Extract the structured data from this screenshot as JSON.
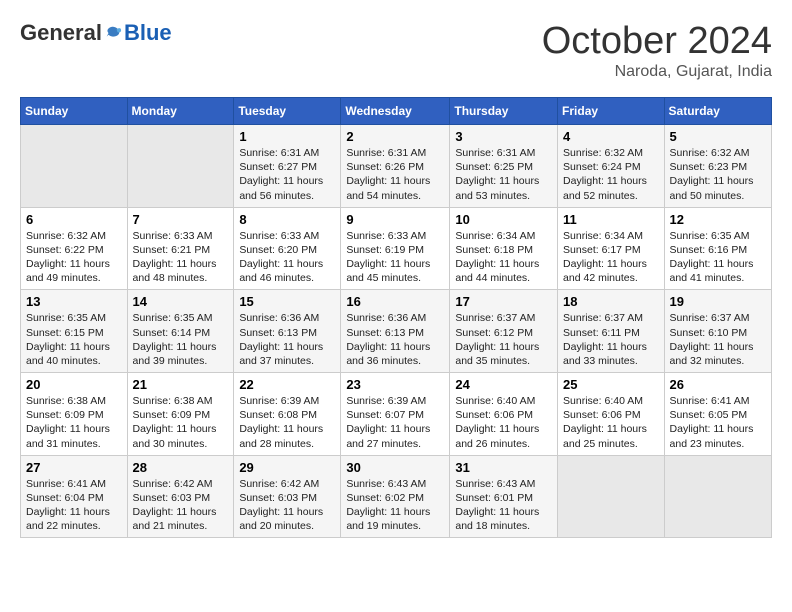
{
  "header": {
    "logo_general": "General",
    "logo_blue": "Blue",
    "month": "October 2024",
    "location": "Naroda, Gujarat, India"
  },
  "days_of_week": [
    "Sunday",
    "Monday",
    "Tuesday",
    "Wednesday",
    "Thursday",
    "Friday",
    "Saturday"
  ],
  "weeks": [
    [
      {
        "day": "",
        "sunrise": "",
        "sunset": "",
        "daylight": "",
        "empty": true
      },
      {
        "day": "",
        "sunrise": "",
        "sunset": "",
        "daylight": "",
        "empty": true
      },
      {
        "day": "1",
        "sunrise": "Sunrise: 6:31 AM",
        "sunset": "Sunset: 6:27 PM",
        "daylight": "Daylight: 11 hours and 56 minutes."
      },
      {
        "day": "2",
        "sunrise": "Sunrise: 6:31 AM",
        "sunset": "Sunset: 6:26 PM",
        "daylight": "Daylight: 11 hours and 54 minutes."
      },
      {
        "day": "3",
        "sunrise": "Sunrise: 6:31 AM",
        "sunset": "Sunset: 6:25 PM",
        "daylight": "Daylight: 11 hours and 53 minutes."
      },
      {
        "day": "4",
        "sunrise": "Sunrise: 6:32 AM",
        "sunset": "Sunset: 6:24 PM",
        "daylight": "Daylight: 11 hours and 52 minutes."
      },
      {
        "day": "5",
        "sunrise": "Sunrise: 6:32 AM",
        "sunset": "Sunset: 6:23 PM",
        "daylight": "Daylight: 11 hours and 50 minutes."
      }
    ],
    [
      {
        "day": "6",
        "sunrise": "Sunrise: 6:32 AM",
        "sunset": "Sunset: 6:22 PM",
        "daylight": "Daylight: 11 hours and 49 minutes."
      },
      {
        "day": "7",
        "sunrise": "Sunrise: 6:33 AM",
        "sunset": "Sunset: 6:21 PM",
        "daylight": "Daylight: 11 hours and 48 minutes."
      },
      {
        "day": "8",
        "sunrise": "Sunrise: 6:33 AM",
        "sunset": "Sunset: 6:20 PM",
        "daylight": "Daylight: 11 hours and 46 minutes."
      },
      {
        "day": "9",
        "sunrise": "Sunrise: 6:33 AM",
        "sunset": "Sunset: 6:19 PM",
        "daylight": "Daylight: 11 hours and 45 minutes."
      },
      {
        "day": "10",
        "sunrise": "Sunrise: 6:34 AM",
        "sunset": "Sunset: 6:18 PM",
        "daylight": "Daylight: 11 hours and 44 minutes."
      },
      {
        "day": "11",
        "sunrise": "Sunrise: 6:34 AM",
        "sunset": "Sunset: 6:17 PM",
        "daylight": "Daylight: 11 hours and 42 minutes."
      },
      {
        "day": "12",
        "sunrise": "Sunrise: 6:35 AM",
        "sunset": "Sunset: 6:16 PM",
        "daylight": "Daylight: 11 hours and 41 minutes."
      }
    ],
    [
      {
        "day": "13",
        "sunrise": "Sunrise: 6:35 AM",
        "sunset": "Sunset: 6:15 PM",
        "daylight": "Daylight: 11 hours and 40 minutes."
      },
      {
        "day": "14",
        "sunrise": "Sunrise: 6:35 AM",
        "sunset": "Sunset: 6:14 PM",
        "daylight": "Daylight: 11 hours and 39 minutes."
      },
      {
        "day": "15",
        "sunrise": "Sunrise: 6:36 AM",
        "sunset": "Sunset: 6:13 PM",
        "daylight": "Daylight: 11 hours and 37 minutes."
      },
      {
        "day": "16",
        "sunrise": "Sunrise: 6:36 AM",
        "sunset": "Sunset: 6:13 PM",
        "daylight": "Daylight: 11 hours and 36 minutes."
      },
      {
        "day": "17",
        "sunrise": "Sunrise: 6:37 AM",
        "sunset": "Sunset: 6:12 PM",
        "daylight": "Daylight: 11 hours and 35 minutes."
      },
      {
        "day": "18",
        "sunrise": "Sunrise: 6:37 AM",
        "sunset": "Sunset: 6:11 PM",
        "daylight": "Daylight: 11 hours and 33 minutes."
      },
      {
        "day": "19",
        "sunrise": "Sunrise: 6:37 AM",
        "sunset": "Sunset: 6:10 PM",
        "daylight": "Daylight: 11 hours and 32 minutes."
      }
    ],
    [
      {
        "day": "20",
        "sunrise": "Sunrise: 6:38 AM",
        "sunset": "Sunset: 6:09 PM",
        "daylight": "Daylight: 11 hours and 31 minutes."
      },
      {
        "day": "21",
        "sunrise": "Sunrise: 6:38 AM",
        "sunset": "Sunset: 6:09 PM",
        "daylight": "Daylight: 11 hours and 30 minutes."
      },
      {
        "day": "22",
        "sunrise": "Sunrise: 6:39 AM",
        "sunset": "Sunset: 6:08 PM",
        "daylight": "Daylight: 11 hours and 28 minutes."
      },
      {
        "day": "23",
        "sunrise": "Sunrise: 6:39 AM",
        "sunset": "Sunset: 6:07 PM",
        "daylight": "Daylight: 11 hours and 27 minutes."
      },
      {
        "day": "24",
        "sunrise": "Sunrise: 6:40 AM",
        "sunset": "Sunset: 6:06 PM",
        "daylight": "Daylight: 11 hours and 26 minutes."
      },
      {
        "day": "25",
        "sunrise": "Sunrise: 6:40 AM",
        "sunset": "Sunset: 6:06 PM",
        "daylight": "Daylight: 11 hours and 25 minutes."
      },
      {
        "day": "26",
        "sunrise": "Sunrise: 6:41 AM",
        "sunset": "Sunset: 6:05 PM",
        "daylight": "Daylight: 11 hours and 23 minutes."
      }
    ],
    [
      {
        "day": "27",
        "sunrise": "Sunrise: 6:41 AM",
        "sunset": "Sunset: 6:04 PM",
        "daylight": "Daylight: 11 hours and 22 minutes."
      },
      {
        "day": "28",
        "sunrise": "Sunrise: 6:42 AM",
        "sunset": "Sunset: 6:03 PM",
        "daylight": "Daylight: 11 hours and 21 minutes."
      },
      {
        "day": "29",
        "sunrise": "Sunrise: 6:42 AM",
        "sunset": "Sunset: 6:03 PM",
        "daylight": "Daylight: 11 hours and 20 minutes."
      },
      {
        "day": "30",
        "sunrise": "Sunrise: 6:43 AM",
        "sunset": "Sunset: 6:02 PM",
        "daylight": "Daylight: 11 hours and 19 minutes."
      },
      {
        "day": "31",
        "sunrise": "Sunrise: 6:43 AM",
        "sunset": "Sunset: 6:01 PM",
        "daylight": "Daylight: 11 hours and 18 minutes."
      },
      {
        "day": "",
        "sunrise": "",
        "sunset": "",
        "daylight": "",
        "empty": true
      },
      {
        "day": "",
        "sunrise": "",
        "sunset": "",
        "daylight": "",
        "empty": true
      }
    ]
  ]
}
